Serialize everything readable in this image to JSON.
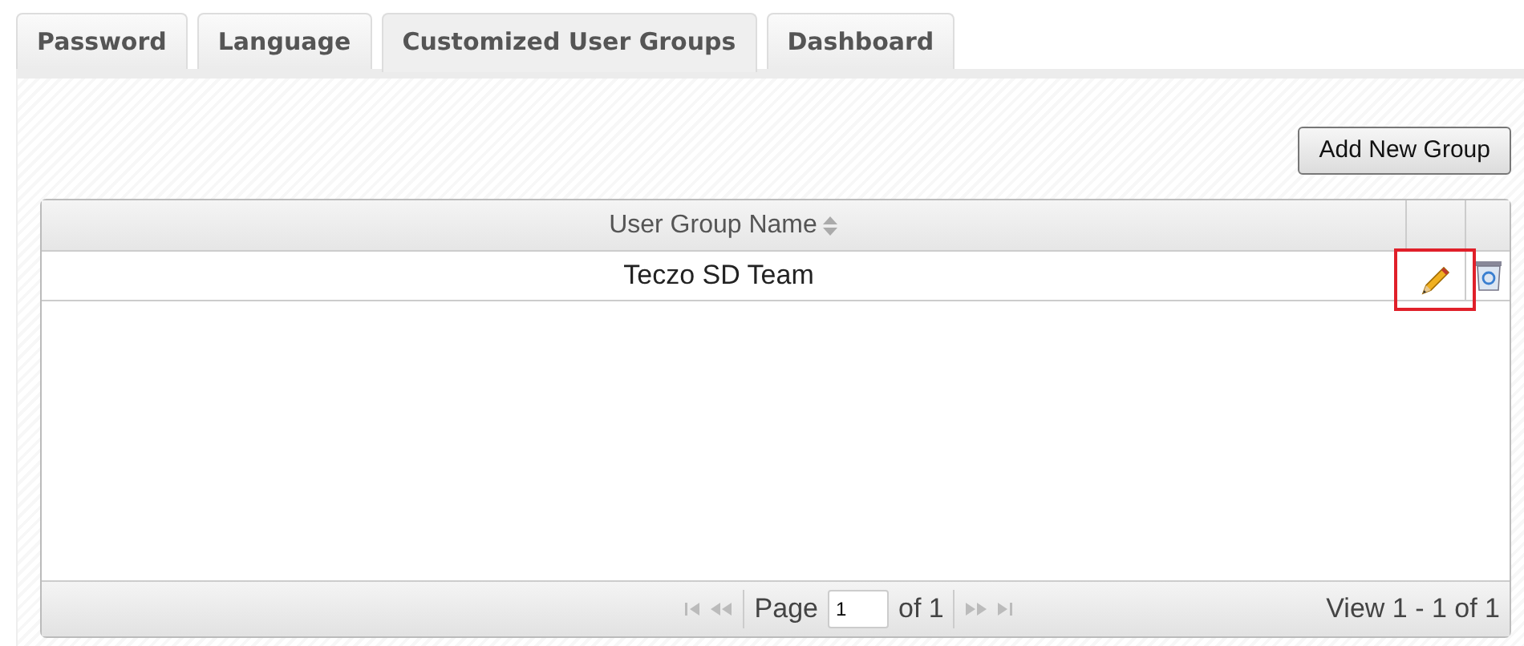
{
  "tabs": [
    {
      "label": "Password",
      "selected": false
    },
    {
      "label": "Language",
      "selected": false
    },
    {
      "label": "Customized User Groups",
      "selected": true
    },
    {
      "label": "Dashboard",
      "selected": false
    }
  ],
  "add_button": "Add New Group",
  "table": {
    "columns": [
      "User Group Name"
    ],
    "rows": [
      {
        "name": "Teczo SD Team",
        "highlighted": true
      }
    ]
  },
  "pager": {
    "page_label": "Page",
    "page_value": "1",
    "of_label": "of 1",
    "view": "View 1 - 1 of 1"
  }
}
